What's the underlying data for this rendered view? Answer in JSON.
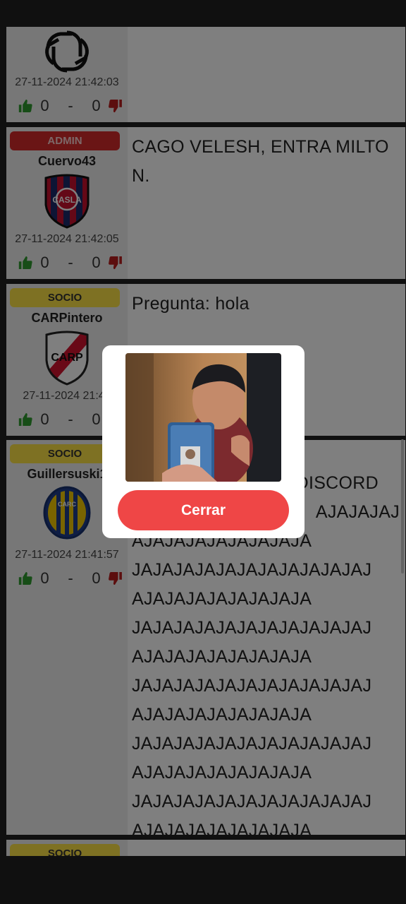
{
  "posts": [
    {
      "timestamp": "27-11-2024 21:42:03",
      "likes": "0",
      "separator": "-",
      "dislikes": "0",
      "avatar": "openai-logo-icon",
      "message": ""
    },
    {
      "role": "ADMIN",
      "username": "Cuervo43",
      "avatar": "san-lorenzo-crest-icon",
      "timestamp": "27-11-2024 21:42:05",
      "likes": "0",
      "separator": "-",
      "dislikes": "0",
      "message": "CAGO VELESH, ENTRA MILTON."
    },
    {
      "role": "SOCIO",
      "username": "CARPintero",
      "avatar": "river-plate-crest-icon",
      "timestamp": "27-11-2024 21:42",
      "likes": "0",
      "separator": "-",
      "dislikes": "0",
      "message": "Pregunta: hola"
    },
    {
      "role": "SOCIO",
      "username": "Guillersuski1",
      "avatar": "rosario-central-crest-icon",
      "timestamp": "27-11-2024 21:41:57",
      "likes": "0",
      "separator": "-",
      "dislikes": "0",
      "message_tail": "DISCORD",
      "message_lines": [
        "AJAJAJAJ",
        "AJAJAJAJAJAJAJAJA",
        "JAJAJAJAJAJAJAJAJAJAJAJ",
        "AJAJAJAJAJAJAJAJA",
        "JAJAJAJAJAJAJAJAJAJAJAJ",
        "AJAJAJAJAJAJAJAJA",
        "JAJAJAJAJAJAJAJAJAJAJAJ",
        "AJAJAJAJAJAJAJAJA",
        "JAJAJAJAJAJAJAJAJAJAJAJ",
        "AJAJAJAJAJAJAJAJA",
        "JAJAJAJAJAJAJAJAJAJAJAJ",
        "AJAJAJAJAJAJAJAJA"
      ]
    },
    {
      "role": "SOCIO"
    }
  ],
  "modal": {
    "close_label": "Cerrar"
  },
  "colors": {
    "admin": "#d42a2a",
    "socio": "#fde246",
    "like": "#2e9b2e",
    "dislike": "#b81c1c",
    "close_button": "#ef4646"
  }
}
